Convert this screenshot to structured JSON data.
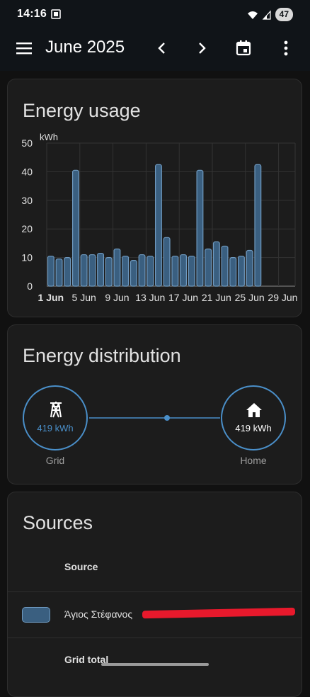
{
  "status": {
    "time": "14:16",
    "battery": "47"
  },
  "app_bar": {
    "title": "June 2025"
  },
  "usage_card": {
    "title": "Energy usage"
  },
  "distribution_card": {
    "title": "Energy distribution",
    "grid": {
      "value": "419 kWh",
      "label": "Grid"
    },
    "home": {
      "value": "419 kWh",
      "label": "Home"
    }
  },
  "sources_card": {
    "title": "Sources",
    "column_header": "Source",
    "rows": [
      {
        "name": "Άγιος Στέφανος"
      }
    ],
    "partial_row": "Grid total"
  },
  "colors": {
    "accent": "#4a8fc9",
    "bar_fill": "#3a5f80",
    "redaction": "#e8192c"
  },
  "chart_data": {
    "type": "bar",
    "ylabel": "kWh",
    "ylim": [
      0,
      50
    ],
    "yticks": [
      "0",
      "10",
      "20",
      "30",
      "40",
      "50"
    ],
    "categories": [
      "1 Jun",
      "2 Jun",
      "3 Jun",
      "4 Jun",
      "5 Jun",
      "6 Jun",
      "7 Jun",
      "8 Jun",
      "9 Jun",
      "10 Jun",
      "11 Jun",
      "12 Jun",
      "13 Jun",
      "14 Jun",
      "15 Jun",
      "16 Jun",
      "17 Jun",
      "18 Jun",
      "19 Jun",
      "20 Jun",
      "21 Jun",
      "22 Jun",
      "23 Jun",
      "24 Jun",
      "25 Jun",
      "26 Jun",
      "27 Jun",
      "28 Jun",
      "29 Jun",
      "30 Jun"
    ],
    "values": [
      10.5,
      9.5,
      10,
      40.5,
      11,
      11,
      11.5,
      10,
      13,
      10.5,
      9,
      11,
      10.5,
      42.5,
      17,
      10.5,
      11,
      10.5,
      40.5,
      13,
      15.5,
      14,
      10,
      10.5,
      12.5,
      42.5,
      null,
      null,
      null,
      null
    ],
    "xtick_labels": [
      {
        "label": "1 Jun",
        "index": 0,
        "bold": true
      },
      {
        "label": "5 Jun",
        "index": 4
      },
      {
        "label": "9 Jun",
        "index": 8
      },
      {
        "label": "13 Jun",
        "index": 12
      },
      {
        "label": "17 Jun",
        "index": 16
      },
      {
        "label": "21 Jun",
        "index": 20
      },
      {
        "label": "25 Jun",
        "index": 24
      },
      {
        "label": "29 Jun",
        "index": 28
      }
    ],
    "grid": true
  }
}
